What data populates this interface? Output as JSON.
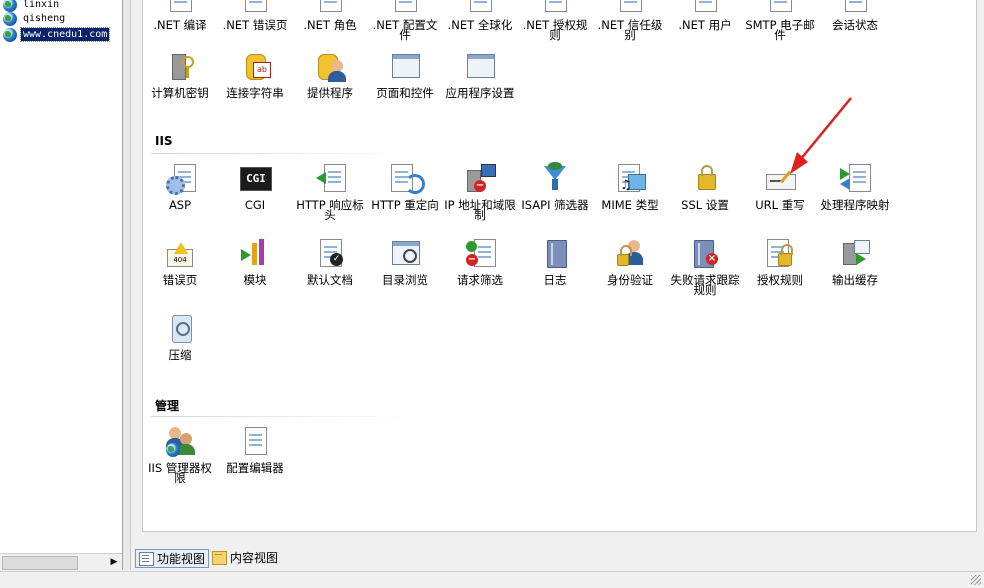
{
  "tree": {
    "items": [
      {
        "label": "linxin",
        "selected": false
      },
      {
        "label": "qisheng",
        "selected": false
      },
      {
        "label": "www.cnedu1.com",
        "selected": true
      }
    ]
  },
  "aspnet_row1": [
    ".NET 编译",
    ".NET 错误页",
    ".NET 角色",
    ".NET 配置文件",
    ".NET 全球化",
    ".NET 授权规则",
    ".NET 信任级别",
    ".NET 用户",
    "SMTP 电子邮件",
    "会话状态"
  ],
  "aspnet_row2": [
    "计算机密钥",
    "连接字符串",
    "提供程序",
    "页面和控件",
    "应用程序设置"
  ],
  "iis": {
    "title": "IIS",
    "row1": [
      "ASP",
      "CGI",
      "HTTP 响应标头",
      "HTTP 重定向",
      "IP 地址和域限制",
      "ISAPI 筛选器",
      "MIME 类型",
      "SSL 设置",
      "URL 重写",
      "处理程序映射"
    ],
    "row2": [
      "错误页",
      "模块",
      "默认文档",
      "目录浏览",
      "请求筛选",
      "日志",
      "身份验证",
      "失败请求跟踪规则",
      "授权规则",
      "输出缓存"
    ],
    "row3": [
      "压缩"
    ],
    "cgi_badge": "CGI",
    "error_badge": "404"
  },
  "management": {
    "title": "管理",
    "items": [
      "IIS 管理器权限",
      "配置编辑器"
    ]
  },
  "bottom_tabs": {
    "features_view": "功能视图",
    "content_view": "内容视图"
  },
  "colors": {
    "selection": "#0a246a",
    "annotation_arrow": "#e02020"
  }
}
